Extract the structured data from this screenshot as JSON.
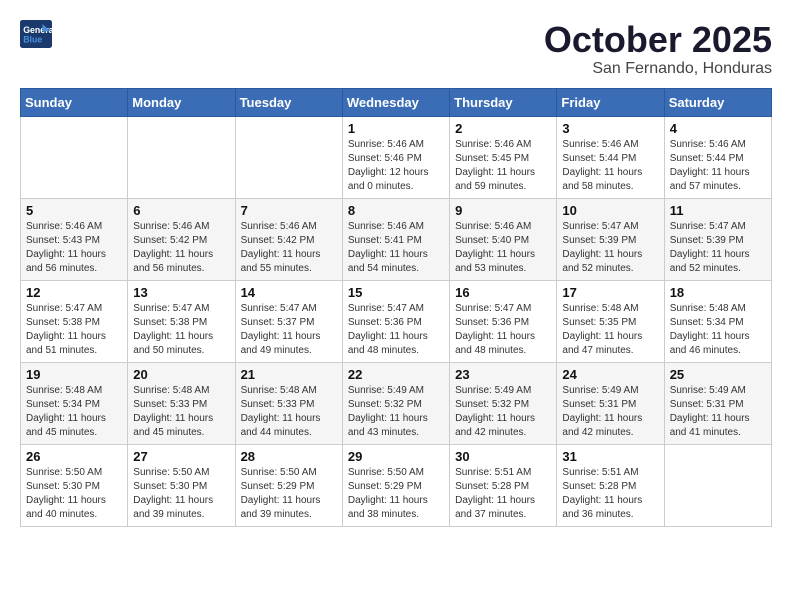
{
  "header": {
    "logo_line1": "General",
    "logo_line2": "Blue",
    "month": "October 2025",
    "location": "San Fernando, Honduras"
  },
  "weekdays": [
    "Sunday",
    "Monday",
    "Tuesday",
    "Wednesday",
    "Thursday",
    "Friday",
    "Saturday"
  ],
  "weeks": [
    [
      {
        "day": "",
        "info": ""
      },
      {
        "day": "",
        "info": ""
      },
      {
        "day": "",
        "info": ""
      },
      {
        "day": "1",
        "info": "Sunrise: 5:46 AM\nSunset: 5:46 PM\nDaylight: 12 hours\nand 0 minutes."
      },
      {
        "day": "2",
        "info": "Sunrise: 5:46 AM\nSunset: 5:45 PM\nDaylight: 11 hours\nand 59 minutes."
      },
      {
        "day": "3",
        "info": "Sunrise: 5:46 AM\nSunset: 5:44 PM\nDaylight: 11 hours\nand 58 minutes."
      },
      {
        "day": "4",
        "info": "Sunrise: 5:46 AM\nSunset: 5:44 PM\nDaylight: 11 hours\nand 57 minutes."
      }
    ],
    [
      {
        "day": "5",
        "info": "Sunrise: 5:46 AM\nSunset: 5:43 PM\nDaylight: 11 hours\nand 56 minutes."
      },
      {
        "day": "6",
        "info": "Sunrise: 5:46 AM\nSunset: 5:42 PM\nDaylight: 11 hours\nand 56 minutes."
      },
      {
        "day": "7",
        "info": "Sunrise: 5:46 AM\nSunset: 5:42 PM\nDaylight: 11 hours\nand 55 minutes."
      },
      {
        "day": "8",
        "info": "Sunrise: 5:46 AM\nSunset: 5:41 PM\nDaylight: 11 hours\nand 54 minutes."
      },
      {
        "day": "9",
        "info": "Sunrise: 5:46 AM\nSunset: 5:40 PM\nDaylight: 11 hours\nand 53 minutes."
      },
      {
        "day": "10",
        "info": "Sunrise: 5:47 AM\nSunset: 5:39 PM\nDaylight: 11 hours\nand 52 minutes."
      },
      {
        "day": "11",
        "info": "Sunrise: 5:47 AM\nSunset: 5:39 PM\nDaylight: 11 hours\nand 52 minutes."
      }
    ],
    [
      {
        "day": "12",
        "info": "Sunrise: 5:47 AM\nSunset: 5:38 PM\nDaylight: 11 hours\nand 51 minutes."
      },
      {
        "day": "13",
        "info": "Sunrise: 5:47 AM\nSunset: 5:38 PM\nDaylight: 11 hours\nand 50 minutes."
      },
      {
        "day": "14",
        "info": "Sunrise: 5:47 AM\nSunset: 5:37 PM\nDaylight: 11 hours\nand 49 minutes."
      },
      {
        "day": "15",
        "info": "Sunrise: 5:47 AM\nSunset: 5:36 PM\nDaylight: 11 hours\nand 48 minutes."
      },
      {
        "day": "16",
        "info": "Sunrise: 5:47 AM\nSunset: 5:36 PM\nDaylight: 11 hours\nand 48 minutes."
      },
      {
        "day": "17",
        "info": "Sunrise: 5:48 AM\nSunset: 5:35 PM\nDaylight: 11 hours\nand 47 minutes."
      },
      {
        "day": "18",
        "info": "Sunrise: 5:48 AM\nSunset: 5:34 PM\nDaylight: 11 hours\nand 46 minutes."
      }
    ],
    [
      {
        "day": "19",
        "info": "Sunrise: 5:48 AM\nSunset: 5:34 PM\nDaylight: 11 hours\nand 45 minutes."
      },
      {
        "day": "20",
        "info": "Sunrise: 5:48 AM\nSunset: 5:33 PM\nDaylight: 11 hours\nand 45 minutes."
      },
      {
        "day": "21",
        "info": "Sunrise: 5:48 AM\nSunset: 5:33 PM\nDaylight: 11 hours\nand 44 minutes."
      },
      {
        "day": "22",
        "info": "Sunrise: 5:49 AM\nSunset: 5:32 PM\nDaylight: 11 hours\nand 43 minutes."
      },
      {
        "day": "23",
        "info": "Sunrise: 5:49 AM\nSunset: 5:32 PM\nDaylight: 11 hours\nand 42 minutes."
      },
      {
        "day": "24",
        "info": "Sunrise: 5:49 AM\nSunset: 5:31 PM\nDaylight: 11 hours\nand 42 minutes."
      },
      {
        "day": "25",
        "info": "Sunrise: 5:49 AM\nSunset: 5:31 PM\nDaylight: 11 hours\nand 41 minutes."
      }
    ],
    [
      {
        "day": "26",
        "info": "Sunrise: 5:50 AM\nSunset: 5:30 PM\nDaylight: 11 hours\nand 40 minutes."
      },
      {
        "day": "27",
        "info": "Sunrise: 5:50 AM\nSunset: 5:30 PM\nDaylight: 11 hours\nand 39 minutes."
      },
      {
        "day": "28",
        "info": "Sunrise: 5:50 AM\nSunset: 5:29 PM\nDaylight: 11 hours\nand 39 minutes."
      },
      {
        "day": "29",
        "info": "Sunrise: 5:50 AM\nSunset: 5:29 PM\nDaylight: 11 hours\nand 38 minutes."
      },
      {
        "day": "30",
        "info": "Sunrise: 5:51 AM\nSunset: 5:28 PM\nDaylight: 11 hours\nand 37 minutes."
      },
      {
        "day": "31",
        "info": "Sunrise: 5:51 AM\nSunset: 5:28 PM\nDaylight: 11 hours\nand 36 minutes."
      },
      {
        "day": "",
        "info": ""
      }
    ]
  ]
}
